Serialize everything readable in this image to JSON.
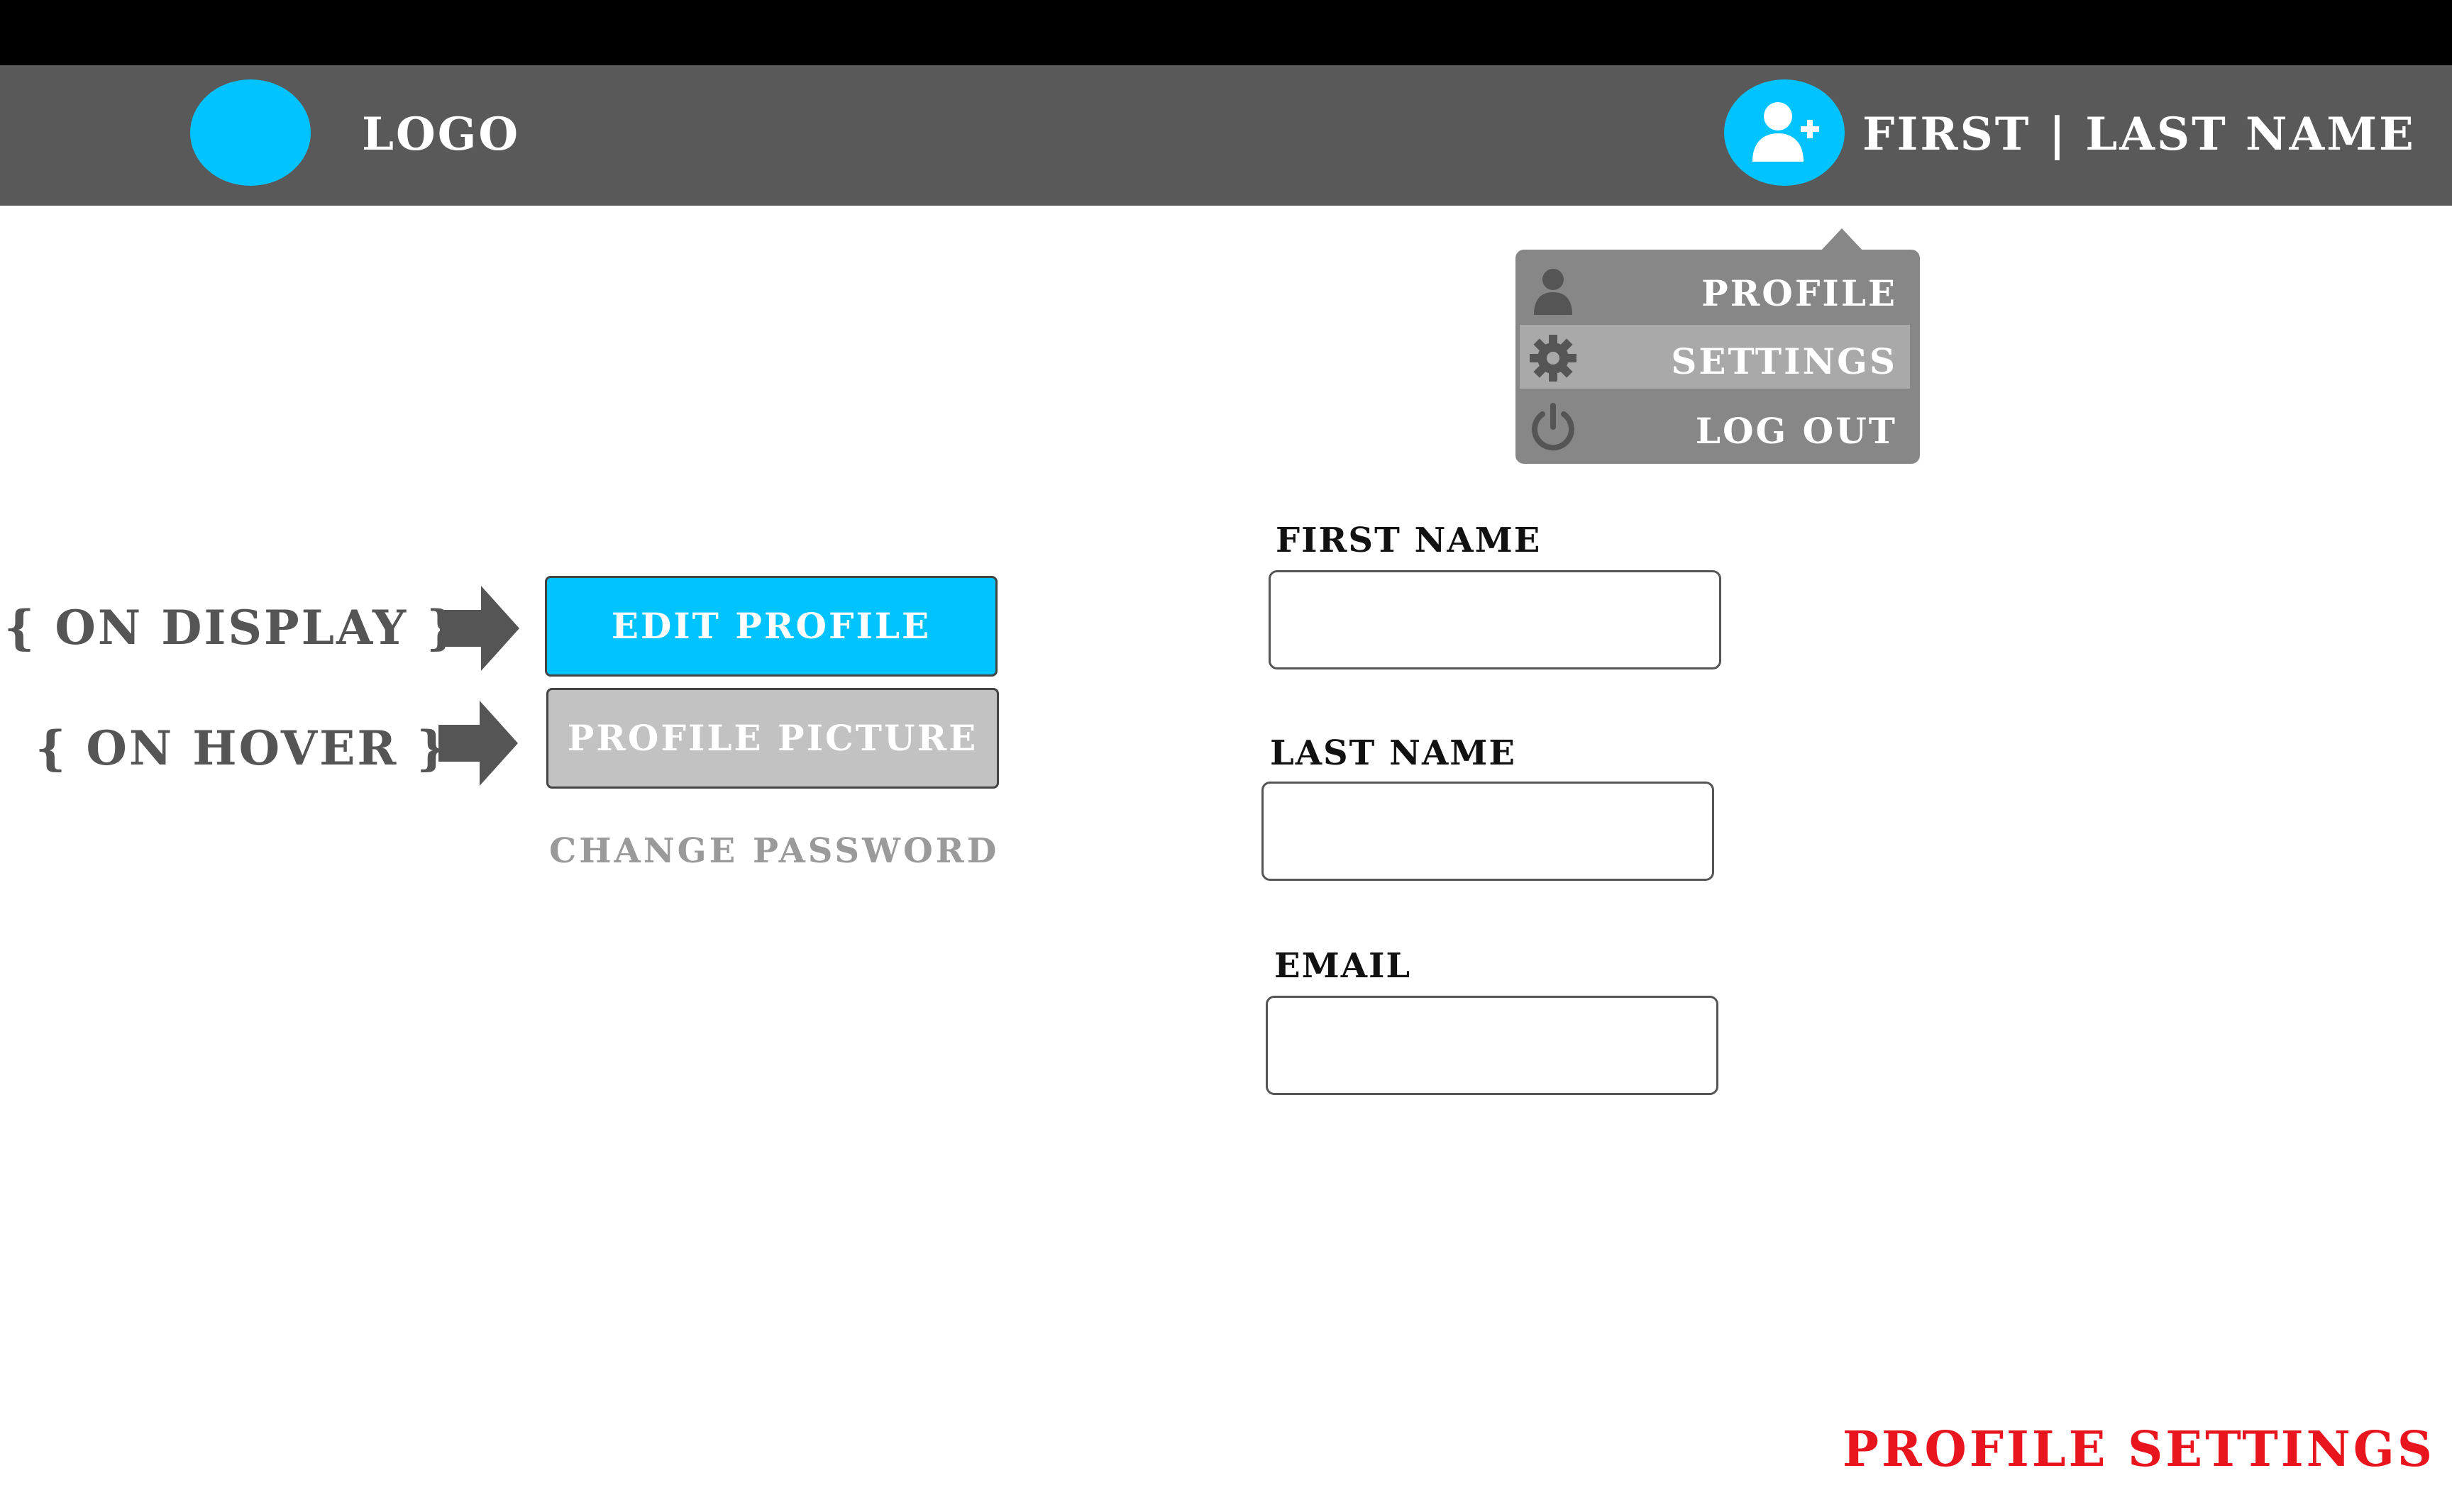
{
  "header": {
    "logo_text": "LOGO",
    "user_name": "FIRST | LAST NAME"
  },
  "user_menu": {
    "items": [
      {
        "label": "PROFILE",
        "icon": "user-icon",
        "active": false
      },
      {
        "label": "SETTINGS",
        "icon": "gear-icon",
        "active": true
      },
      {
        "label": "LOG OUT",
        "icon": "power-icon",
        "active": false
      }
    ]
  },
  "states": {
    "display_label": "{ ON DISPLAY }",
    "hover_label": "{ ON HOVER }"
  },
  "actions": {
    "edit_profile": "EDIT PROFILE",
    "profile_picture": "PROFILE PICTURE",
    "change_password": "CHANGE PASSWORD"
  },
  "form": {
    "first_name_label": "FIRST NAME",
    "first_name_value": "",
    "last_name_label": "LAST NAME",
    "last_name_value": "",
    "email_label": "EMAIL",
    "email_value": ""
  },
  "page_title": "PROFILE SETTINGS",
  "colors": {
    "accent": "#00c3ff",
    "header_bg": "#595959",
    "menu_bg": "#878787",
    "menu_active": "#a9a9a9",
    "title_red": "#e8141e"
  }
}
